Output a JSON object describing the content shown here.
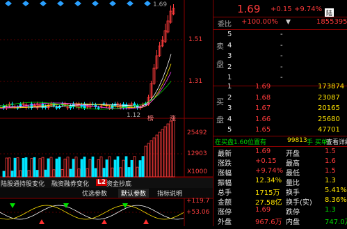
{
  "chart": {
    "candle_high_label": "1.69",
    "candle_low_label": "1.12",
    "price_axis": [
      "1.51",
      "1.31"
    ],
    "volume_axis": [
      "25492",
      "12903",
      "X1000"
    ],
    "macd_axis": [
      "+119.7",
      "+53.06"
    ],
    "marker_labels": [
      "榜",
      "涨"
    ]
  },
  "tabs": {
    "t1": "陆股通持股变化",
    "t2": "融资融券变化",
    "l2": "L2",
    "t3": "资金抄底"
  },
  "subtabs": {
    "s1": "优选参数",
    "s2": "默认参数",
    "s3": "指标说明"
  },
  "quote": {
    "price": "1.69",
    "change": "+0.15",
    "change_pct": "+9.74%",
    "badge": "陆",
    "weibi_label": "委比",
    "weibi_value": "+100.00%",
    "weicha_value": "1855395"
  },
  "sell_label": [
    "卖",
    "盘"
  ],
  "buy_label": [
    "买",
    "盘"
  ],
  "sell_levels": [
    {
      "level": "5",
      "price": "-",
      "vol": ""
    },
    {
      "level": "4",
      "price": "-",
      "vol": ""
    },
    {
      "level": "3",
      "price": "-",
      "vol": ""
    },
    {
      "level": "2",
      "price": "-",
      "vol": ""
    },
    {
      "level": "1",
      "price": "-",
      "vol": ""
    }
  ],
  "buy_levels": [
    {
      "level": "1",
      "price": "1.69",
      "vol": "173874"
    },
    {
      "level": "2",
      "price": "1.68",
      "vol": "23087"
    },
    {
      "level": "3",
      "price": "1.67",
      "vol": "20165"
    },
    {
      "level": "4",
      "price": "1.66",
      "vol": "25680"
    },
    {
      "level": "5",
      "price": "1.65",
      "vol": "47701"
    }
  ],
  "trade_bar": {
    "text1": "在买盘1.60位置有",
    "vol": "99813",
    "text2": "手 买单!",
    "link": "查看详细"
  },
  "stats": [
    {
      "l1": "最新",
      "v1": "1.69",
      "c1": "red",
      "l2": "开盘",
      "v2": "1.5",
      "c2": "red"
    },
    {
      "l1": "涨跌",
      "v1": "+0.15",
      "c1": "red",
      "l2": "最高",
      "v2": "1.6",
      "c2": "red"
    },
    {
      "l1": "涨幅",
      "v1": "+9.74%",
      "c1": "red",
      "l2": "最低",
      "v2": "1.5",
      "c2": "red"
    },
    {
      "l1": "振幅",
      "v1": "12.34%",
      "c1": "yellow",
      "l2": "量比",
      "v2": "1.3",
      "c2": "yellow"
    },
    {
      "l1": "总手",
      "v1": "1715万",
      "c1": "yellow",
      "l2": "换手",
      "v2": "5.41%",
      "c2": "yellow"
    },
    {
      "l1": "金额",
      "v1": "27.58亿",
      "c1": "yellow",
      "l2": "换手(实)",
      "v2": "8.36%",
      "c2": "yellow"
    },
    {
      "l1": "涨停",
      "v1": "1.69",
      "c1": "red",
      "l2": "跌停",
      "v2": "1.3",
      "c2": "green"
    },
    {
      "l1": "外盘",
      "v1": "967.6万",
      "c1": "red",
      "l2": "内盘",
      "v2": "747.0万",
      "c2": "green"
    }
  ],
  "colors": {
    "up": "#ff3b3b",
    "down": "#00d800",
    "accent": "#ffe300",
    "cyan": "#00e5ff"
  }
}
